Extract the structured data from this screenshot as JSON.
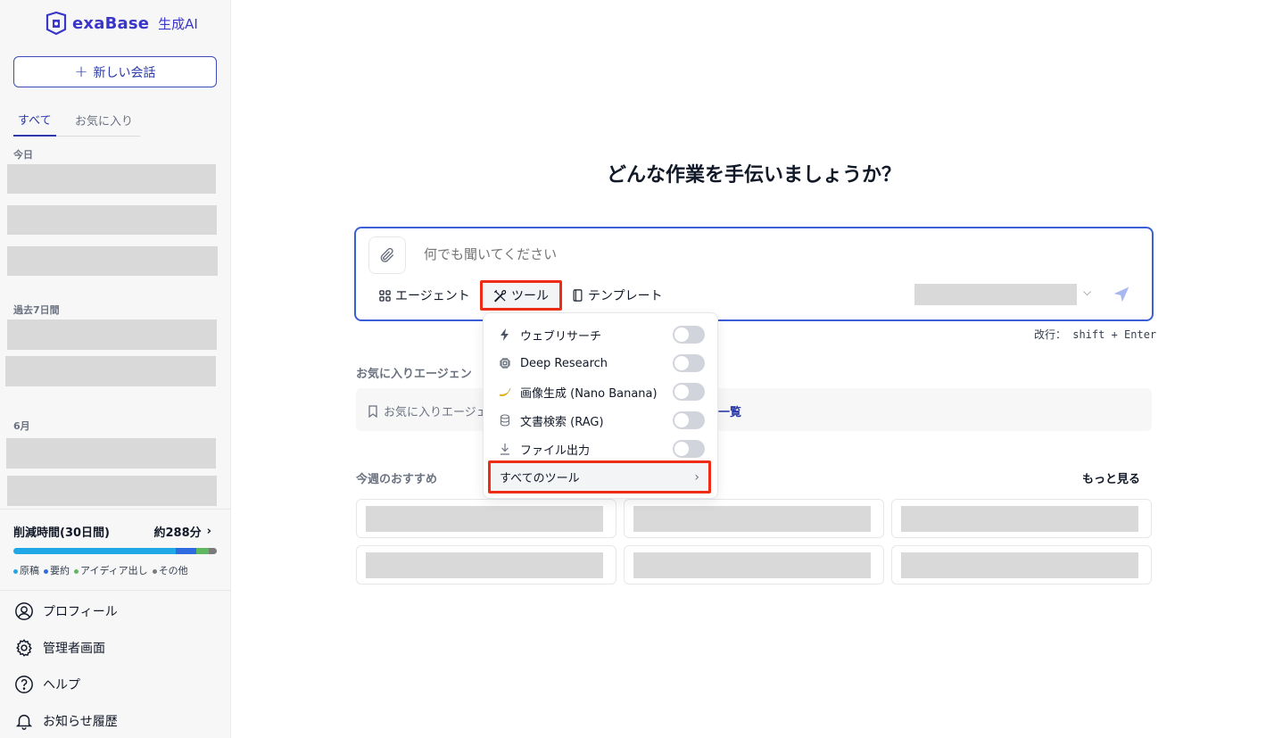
{
  "app": {
    "brand": "exaBase",
    "brand_sub": "生成AI",
    "accent": "#3a37c8"
  },
  "sidebar": {
    "new_chat_label": "新しい会話",
    "tabs": [
      "すべて",
      "お気に入り"
    ],
    "sections": {
      "today": "今日",
      "past7": "過去7日間",
      "june": "6月"
    },
    "stats": {
      "title": "削減時間(30日間)",
      "value": "約288分",
      "bar": [
        {
          "label": "原稿",
          "fraction": 0.8,
          "color": "#1fa7e6"
        },
        {
          "label": "要約",
          "fraction": 0.1,
          "color": "#2f6be0"
        },
        {
          "label": "アイディア出し",
          "fraction": 0.06,
          "color": "#5fb860"
        },
        {
          "label": "その他",
          "fraction": 0.04,
          "color": "#7b7b7b"
        }
      ]
    },
    "menu": {
      "profile": "プロフィール",
      "admin": "管理者画面",
      "help": "ヘルプ",
      "notifications": "お知らせ履歴"
    }
  },
  "main": {
    "title": "どんな作業を手伝いましょうか？",
    "input_placeholder": "何でも聞いてください",
    "buttons": {
      "agent": "エージェント",
      "tools": "ツール",
      "template": "テンプレート"
    },
    "hint": "改行： shift + Enter",
    "favorites_label": "お気に入りエージェン",
    "favorites_text": "お気に入りエージェ",
    "favorites_link": "一覧",
    "recommend_label": "今週のおすすめ",
    "more_label": "もっと見る"
  },
  "tools_menu": {
    "items": [
      {
        "label": "ウェブリサーチ",
        "icon": "lightning-icon",
        "enabled": false
      },
      {
        "label": "Deep Research",
        "icon": "chip-icon",
        "enabled": false
      },
      {
        "label": "画像生成 (Nano Banana)",
        "icon": "banana-icon",
        "enabled": false
      },
      {
        "label": "文書検索 (RAG)",
        "icon": "database-icon",
        "enabled": false
      },
      {
        "label": "ファイル出力",
        "icon": "download-icon",
        "enabled": false
      }
    ],
    "all_tools_label": "すべてのツール"
  }
}
